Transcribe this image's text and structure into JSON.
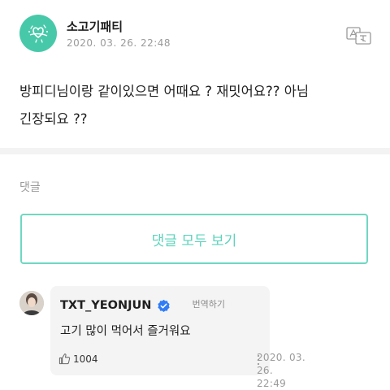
{
  "post": {
    "author": "소고기패티",
    "timestamp": "2020. 03. 26. 22:48",
    "body_line1": "방피디님이랑 같이있으면 어때요 ? 재밋어요?? 아님",
    "body_line2": "긴장되요 ??"
  },
  "comments_section": {
    "label": "댓글",
    "view_all_label": "댓글 모두 보기"
  },
  "comment": {
    "author": "TXT_YEONJUN",
    "translate_label": "번역하기",
    "text": "고기 많이 먹어서 즐거워요",
    "likes": "1004",
    "timestamp_line1": "2020. 03. 26.",
    "timestamp_line2": "22:49"
  },
  "colors": {
    "accent": "#5bd3bb",
    "avatar_bg": "#47c9a9",
    "verified": "#2f7cf6"
  },
  "icons": [
    "translate-icon",
    "verified-icon",
    "like-icon",
    "more-icon"
  ]
}
